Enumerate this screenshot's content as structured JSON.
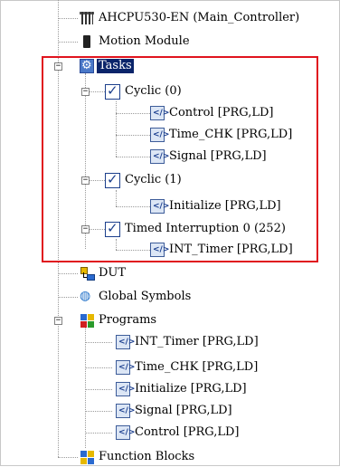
{
  "tree": {
    "controller": "AHCPU530-EN  (Main_Controller)",
    "motion_module": "Motion Module",
    "tasks": {
      "label": "Tasks",
      "groups": [
        {
          "label": "Cyclic (0)",
          "items": [
            "Control [PRG,LD]",
            "Time_CHK [PRG,LD]",
            "Signal [PRG,LD]"
          ]
        },
        {
          "label": "Cyclic (1)",
          "items": [
            "Initialize [PRG,LD]"
          ]
        },
        {
          "label": "Timed Interruption 0 (252)",
          "items": [
            "INT_Timer [PRG,LD]"
          ]
        }
      ]
    },
    "dut": "DUT",
    "global_symbols": "Global Symbols",
    "programs": {
      "label": "Programs",
      "items": [
        "INT_Timer [PRG,LD]",
        "Time_CHK [PRG,LD]",
        "Initialize [PRG,LD]",
        "Signal [PRG,LD]",
        "Control [PRG,LD]"
      ]
    },
    "function_blocks": "Function Blocks"
  },
  "icons": {
    "controller": "plc-cpu-icon",
    "motion_module": "motion-module-icon",
    "tasks": "tasks-gear-icon",
    "task_group": "checkbox-checked-icon",
    "program": "program-icon",
    "dut": "dut-icon",
    "global_symbols": "globe-icon",
    "programs": "programs-folder-icon",
    "function_blocks": "function-blocks-icon"
  },
  "colors": {
    "highlight_box": "#e0141e",
    "selection": "#0a246a"
  }
}
